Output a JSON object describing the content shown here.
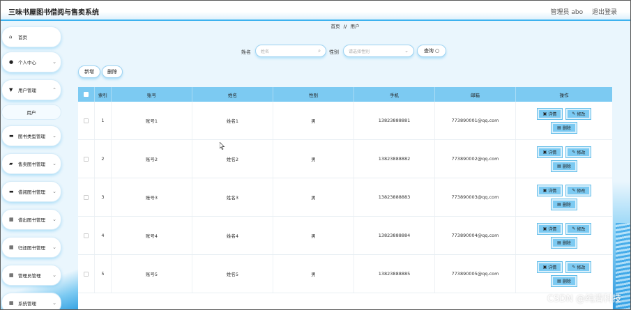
{
  "app": {
    "title": "三味书屋图书借阅与售卖系统"
  },
  "header": {
    "user_label": "管理员 abo",
    "logout_label": "退出登录"
  },
  "sidebar": {
    "items": [
      {
        "label": "首页",
        "icon": "home-icon"
      },
      {
        "label": "个人中心",
        "icon": "person-icon"
      },
      {
        "label": "用户管理",
        "icon": "shield-icon"
      },
      {
        "label": "图书类型管理",
        "icon": "book-icon"
      },
      {
        "label": "售卖图书管理",
        "icon": "thumb-icon"
      },
      {
        "label": "借阅图书管理",
        "icon": "card-icon"
      },
      {
        "label": "借出图书管理",
        "icon": "grid-icon"
      },
      {
        "label": "归还图书管理",
        "icon": "grid-icon"
      },
      {
        "label": "管理员管理",
        "icon": "grid-icon"
      },
      {
        "label": "系统管理",
        "icon": "grid-icon"
      }
    ],
    "sub_item": "用户"
  },
  "breadcrumb": {
    "home": "首页",
    "separator": "//",
    "current": "用户"
  },
  "search": {
    "name_label": "姓名",
    "name_placeholder": "姓名",
    "gender_label": "性别",
    "gender_placeholder": "请选择性别",
    "query_label": "查询"
  },
  "actions": {
    "add_label": "新增",
    "delete_label": "删除"
  },
  "table": {
    "headers": [
      "索引",
      "账号",
      "姓名",
      "性别",
      "手机",
      "邮箱",
      "操作"
    ],
    "rows": [
      {
        "index": "1",
        "account": "账号1",
        "name": "姓名1",
        "gender": "男",
        "phone": "13823888881",
        "email": "773890001@qq.com"
      },
      {
        "index": "2",
        "account": "账号2",
        "name": "姓名2",
        "gender": "男",
        "phone": "13823888882",
        "email": "773890002@qq.com"
      },
      {
        "index": "3",
        "account": "账号3",
        "name": "姓名3",
        "gender": "男",
        "phone": "13823888883",
        "email": "773890003@qq.com"
      },
      {
        "index": "4",
        "account": "账号4",
        "name": "姓名4",
        "gender": "男",
        "phone": "13823888884",
        "email": "773890004@qq.com"
      },
      {
        "index": "5",
        "account": "账号5",
        "name": "姓名5",
        "gender": "男",
        "phone": "13823888885",
        "email": "773890005@qq.com"
      }
    ],
    "op_detail": "详情",
    "op_edit": "修改",
    "op_delete": "删除"
  },
  "watermark": "CSDN @纯清科技",
  "colors": {
    "accent": "#3db2ef",
    "table_header": "#7ccaf2"
  }
}
